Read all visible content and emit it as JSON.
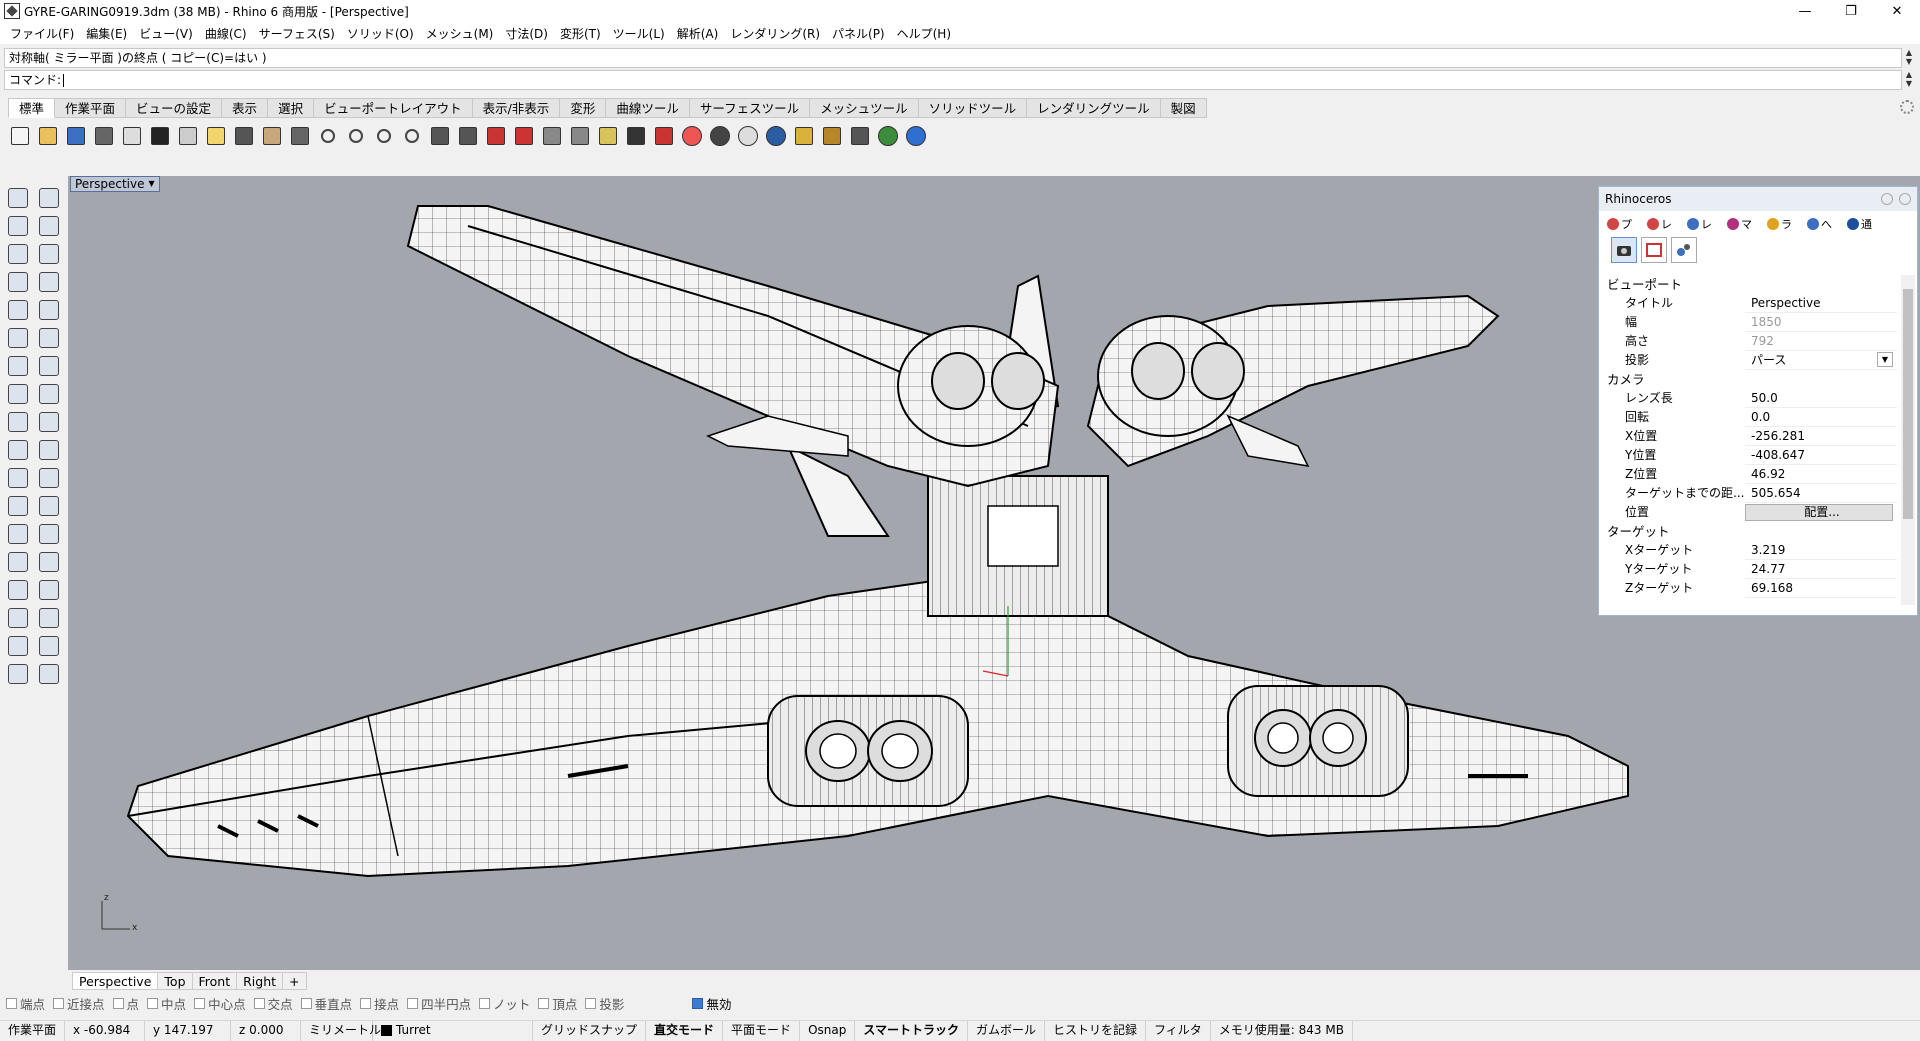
{
  "window": {
    "title": "GYRE-GARING0919.3dm (38 MB) - Rhino 6 商用版 - [Perspective]",
    "controls": [
      "—",
      "❐",
      "✕"
    ]
  },
  "menu": [
    "ファイル(F)",
    "編集(E)",
    "ビュー(V)",
    "曲線(C)",
    "サーフェス(S)",
    "ソリッド(O)",
    "メッシュ(M)",
    "寸法(D)",
    "変形(T)",
    "ツール(L)",
    "解析(A)",
    "レンダリング(R)",
    "パネル(P)",
    "ヘルプ(H)"
  ],
  "command": {
    "history": "対称軸( ミラー平面 )の終点 ( コピー(C)=はい )",
    "prompt": "コマンド:"
  },
  "toolbar_tabs": [
    "標準",
    "作業平面",
    "ビューの設定",
    "表示",
    "選択",
    "ビューポートレイアウト",
    "表示/非表示",
    "変形",
    "曲線ツール",
    "サーフェスツール",
    "メッシュツール",
    "ソリッドツール",
    "レンダリングツール",
    "製図"
  ],
  "toolbar_icons": [
    "new-file-icon",
    "open-folder-icon",
    "save-icon",
    "print-icon",
    "import-icon",
    "cut-icon",
    "copy-icon",
    "paste-icon",
    "undo-icon",
    "pan-hand-icon",
    "move-view-icon",
    "zoom-icon",
    "zoom-window-icon",
    "zoom-extents-icon",
    "zoom-selected-icon",
    "rotate-view-icon",
    "grid-icon",
    "car-icon",
    "shade-car-icon",
    "hide-icon",
    "show-icon",
    "lightbulb-icon",
    "lock-icon",
    "layer-icon",
    "color-wheel-icon",
    "sphere-dark-icon",
    "sphere-white-icon",
    "sphere-blue-icon",
    "cone-icon",
    "gear-cluster-icon",
    "transform-icon",
    "globe-icon",
    "help-icon"
  ],
  "viewport": {
    "active_label": "Perspective",
    "axis_x": "x",
    "axis_z": "z"
  },
  "panel": {
    "title": "Rhinoceros",
    "tabs": [
      "プ",
      "レ",
      "レ",
      "マ",
      "ラ",
      "へ",
      "通"
    ],
    "tab_colors": [
      "#d04545",
      "#d04545",
      "#3c6fbf",
      "#b03080",
      "#e0a020",
      "#3c6fbf",
      "#1f4e9c"
    ],
    "section_viewport": "ビューポート",
    "viewport_props": [
      {
        "k": "タイトル",
        "v": "Perspective",
        "dim": false
      },
      {
        "k": "幅",
        "v": "1850",
        "dim": true
      },
      {
        "k": "高さ",
        "v": "792",
        "dim": true
      },
      {
        "k": "投影",
        "v": "パース",
        "dim": false
      }
    ],
    "section_camera": "カメラ",
    "camera_props": [
      {
        "k": "レンズ長",
        "v": "50.0"
      },
      {
        "k": "回転",
        "v": "0.0"
      },
      {
        "k": "X位置",
        "v": "-256.281"
      },
      {
        "k": "Y位置",
        "v": "-408.647"
      },
      {
        "k": "Z位置",
        "v": "46.92"
      },
      {
        "k": "ターゲットまでの距...",
        "v": "505.654"
      }
    ],
    "position_label": "位置",
    "position_button": "配置...",
    "section_target": "ターゲット",
    "target_props": [
      {
        "k": "Xターゲット",
        "v": "3.219"
      },
      {
        "k": "Yターゲット",
        "v": "24.77"
      },
      {
        "k": "Zターゲット",
        "v": "69.168"
      }
    ]
  },
  "viewport_tabs": [
    "Perspective",
    "Top",
    "Front",
    "Right",
    "+"
  ],
  "osnaps": [
    {
      "label": "端点",
      "on": false
    },
    {
      "label": "近接点",
      "on": false
    },
    {
      "label": "点",
      "on": false
    },
    {
      "label": "中点",
      "on": false
    },
    {
      "label": "中心点",
      "on": false
    },
    {
      "label": "交点",
      "on": false
    },
    {
      "label": "垂直点",
      "on": false
    },
    {
      "label": "接点",
      "on": false
    },
    {
      "label": "四半円点",
      "on": false
    },
    {
      "label": "ノット",
      "on": false
    },
    {
      "label": "頂点",
      "on": false
    },
    {
      "label": "投影",
      "on": false
    },
    {
      "label": "無効",
      "on": true
    }
  ],
  "status": {
    "cplane": "作業平面",
    "x": "x -60.984",
    "y": "y 147.197",
    "z": "z 0.000",
    "units": "ミリメートル",
    "layer": "Turret",
    "grid_snap": "グリッドスナップ",
    "ortho": "直交モード",
    "planar": "平面モード",
    "osnap": "Osnap",
    "smarttrack": "スマートトラック",
    "gumball": "ガムボール",
    "history": "ヒストリを記録",
    "filter": "フィルタ",
    "memory": "メモリ使用量: 843 MB"
  }
}
